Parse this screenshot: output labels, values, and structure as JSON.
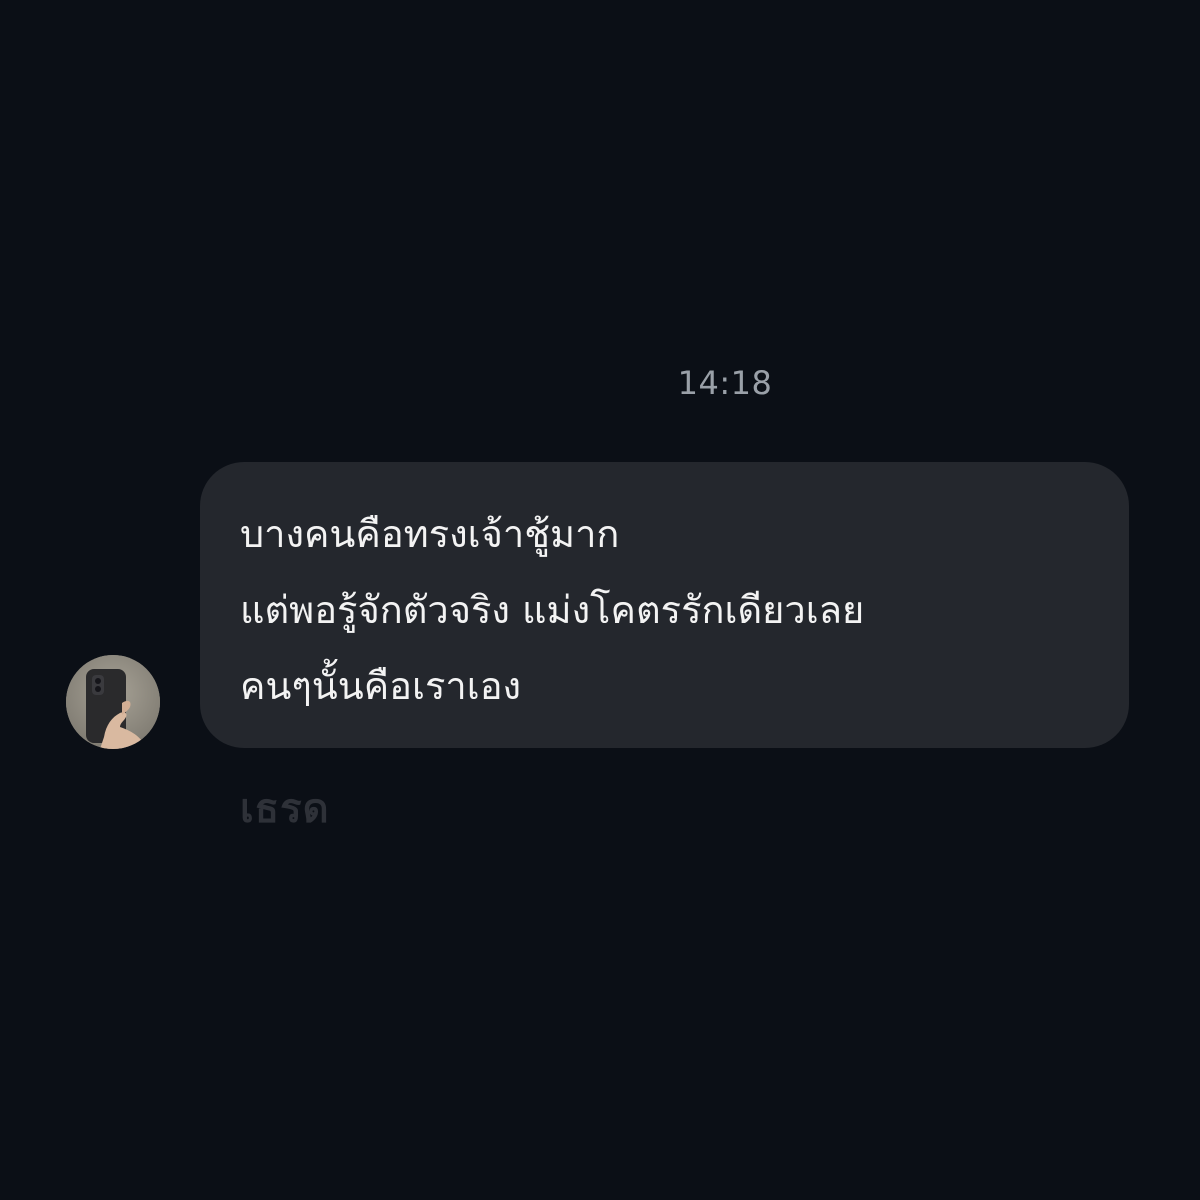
{
  "chat": {
    "timestamp": "14:18",
    "message": {
      "lines": [
        "บางคนคือทรงเจ้าชู้มาก",
        "แต่พอรู้จักตัวจริง แม่งโคตรรักเดียวเลย",
        "คนๆนั้นคือเราเอง"
      ]
    },
    "watermark": "เธรด"
  },
  "colors": {
    "background": "#0b0f16",
    "bubble": "#24272d",
    "message_text": "#f3f3f3",
    "timestamp_text": "#9aa0a8",
    "watermark_text": "#2e3138"
  },
  "icons": {
    "avatar": "avatar-photo-hand-holding-phone"
  }
}
